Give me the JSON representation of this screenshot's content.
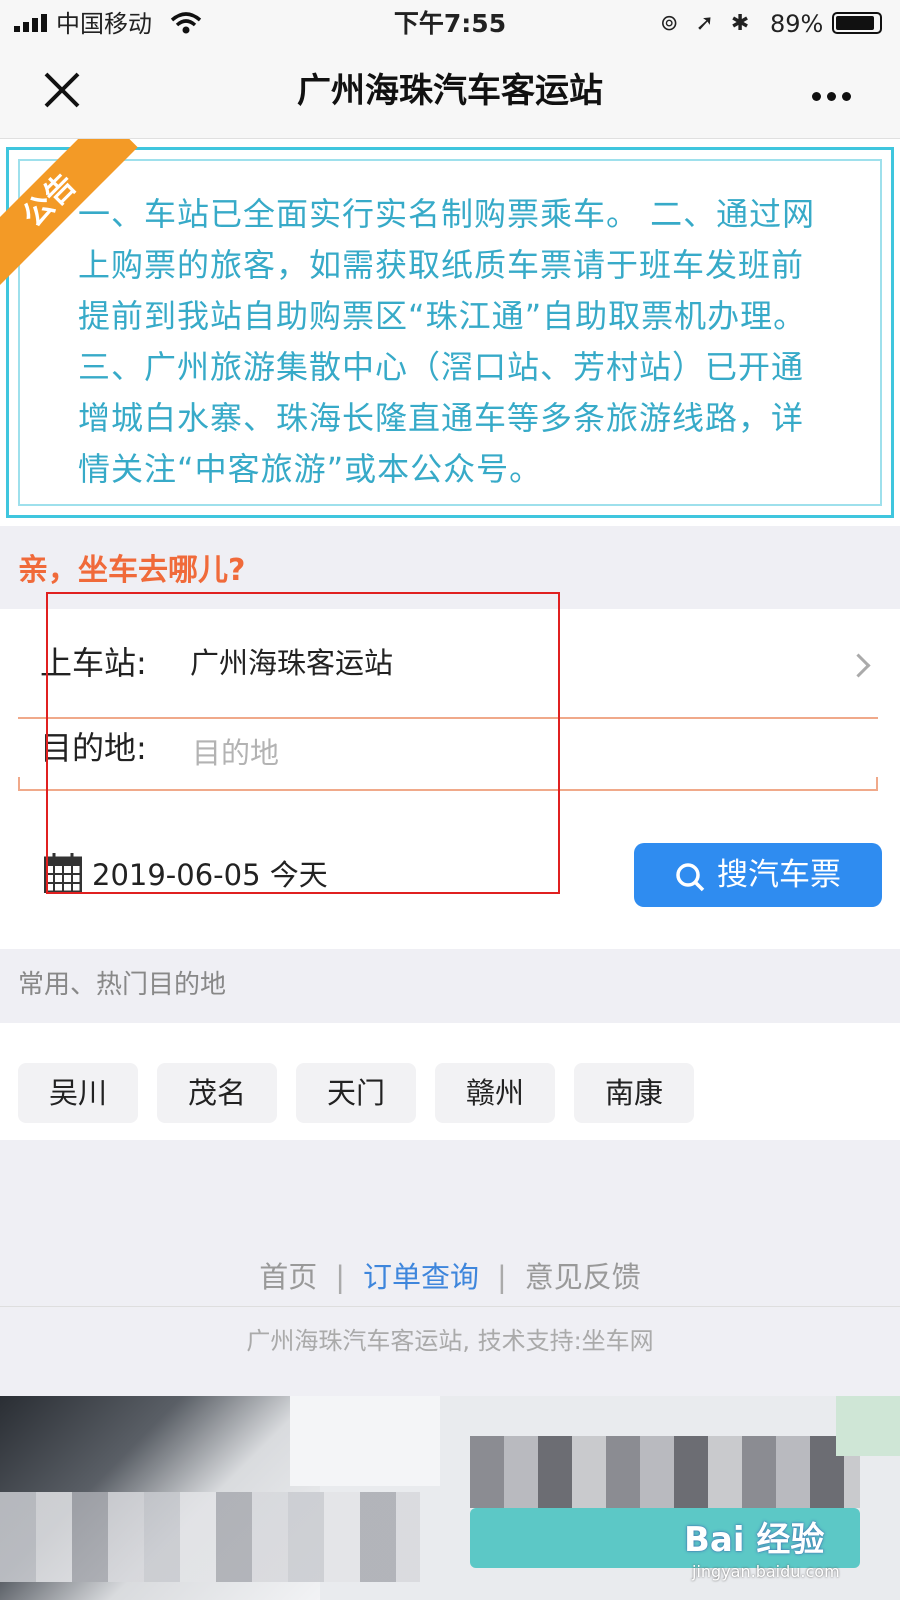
{
  "status_bar": {
    "carrier": "中国移动",
    "time": "下午7:55",
    "battery_pct": "89%",
    "battery_level": 0.89
  },
  "nav": {
    "title": "广州海珠汽车客运站"
  },
  "notice": {
    "ribbon": "公告",
    "text": "一、车站已全面实行实名制购票乘车。 二、通过网上购票的旅客，如需获取纸质车票请于班车发班前提前到我站自助购票区“珠江通”自助取票机办理。 三、广州旅游集散中心（滘口站、芳村站）已开通增城白水寨、珠海长隆直通车等多条旅游线路，详情关注“中客旅游”或本公众号。"
  },
  "form": {
    "question": "亲，坐车去哪儿?",
    "boarding_label": "上车站:",
    "boarding_value": "广州海珠客运站",
    "destination_label": "目的地:",
    "destination_placeholder": "目的地",
    "date": "2019-06-05 今天",
    "search_button": "搜汽车票"
  },
  "common": {
    "header": "常用、热门目的地",
    "tags": [
      "吴川",
      "茂名",
      "天门",
      "赣州",
      "南康"
    ]
  },
  "footer": {
    "links": [
      "首页",
      "订单查询",
      "意见反馈"
    ],
    "active_link": "订单查询",
    "separator": "|",
    "credits": "广州海珠汽车客运站, 技术支持:坐车网"
  },
  "watermark": {
    "logo": "Bai 经验",
    "url": "jingyan.baidu.com"
  },
  "colors": {
    "accent_blue": "#2f8cf0",
    "notice_text": "#37aac8",
    "ribbon_orange": "#f39a26",
    "question_orange": "#f06a3a",
    "annotation_red": "#e02020"
  }
}
